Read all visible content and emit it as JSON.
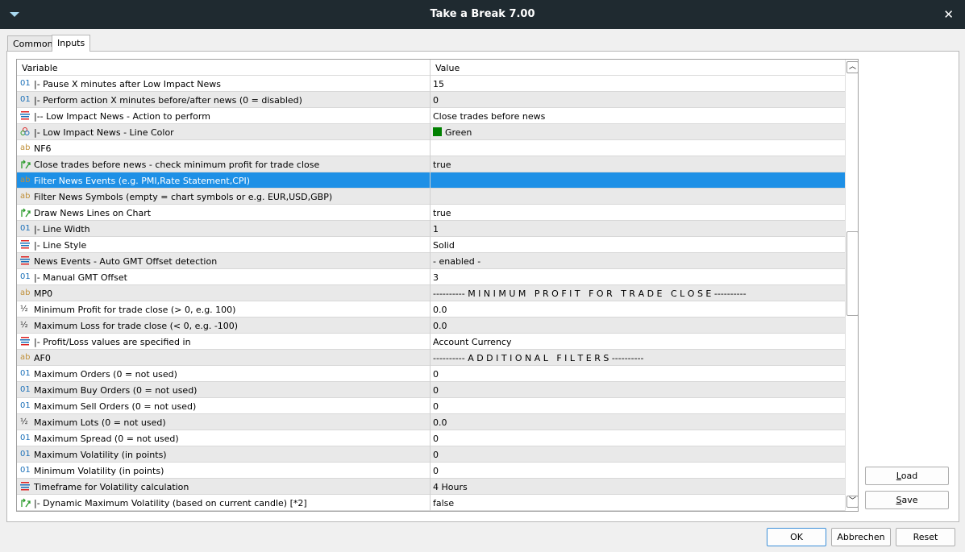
{
  "window": {
    "title": "Take a Break 7.00",
    "close": "✕"
  },
  "tabs": [
    {
      "label": "Common"
    },
    {
      "label": "Inputs"
    }
  ],
  "table": {
    "col_variable": "Variable",
    "col_value": "Value",
    "rows": [
      {
        "icon": "int",
        "variable": "|- Pause X minutes after Low Impact News",
        "value": "15"
      },
      {
        "icon": "int",
        "variable": "|- Perform action X minutes before/after news (0 = disabled)",
        "value": "0"
      },
      {
        "icon": "enum",
        "variable": "|-- Low Impact News - Action to perform",
        "value": "Close trades before news"
      },
      {
        "icon": "color",
        "variable": "|- Low Impact News - Line Color",
        "value": "Green",
        "swatch": "#008000"
      },
      {
        "icon": "string",
        "variable": "NF6",
        "value": ""
      },
      {
        "icon": "bool",
        "variable": "Close trades before news - check minimum profit for trade close",
        "value": "true"
      },
      {
        "icon": "string",
        "variable": "Filter News Events (e.g. PMI,Rate Statement,CPI)",
        "value": "",
        "selected": true
      },
      {
        "icon": "string",
        "variable": "Filter News Symbols (empty = chart symbols or e.g. EUR,USD,GBP)",
        "value": ""
      },
      {
        "icon": "bool",
        "variable": "Draw News Lines on Chart",
        "value": "true"
      },
      {
        "icon": "int",
        "variable": "|- Line Width",
        "value": "1"
      },
      {
        "icon": "enum",
        "variable": "|- Line Style",
        "value": "Solid"
      },
      {
        "icon": "enum",
        "variable": "News Events - Auto GMT Offset detection",
        "value": "- enabled -"
      },
      {
        "icon": "int",
        "variable": "|- Manual GMT Offset",
        "value": "3"
      },
      {
        "icon": "string",
        "variable": "MP0",
        "value": "---------- M I N I M U M   P R O F I T   F O R   T R A D E   C L O S E ----------"
      },
      {
        "icon": "double",
        "variable": "Minimum Profit for trade close (> 0, e.g. 100)",
        "value": "0.0"
      },
      {
        "icon": "double",
        "variable": "Maximum Loss for trade close (< 0, e.g. -100)",
        "value": "0.0"
      },
      {
        "icon": "enum",
        "variable": "|- Profit/Loss values are specified in",
        "value": "Account Currency"
      },
      {
        "icon": "string",
        "variable": "AF0",
        "value": "---------- A D D I T I O N A L   F I L T E R S ----------"
      },
      {
        "icon": "int",
        "variable": "Maximum Orders (0 = not used)",
        "value": "0"
      },
      {
        "icon": "int",
        "variable": "Maximum Buy Orders (0 = not used)",
        "value": "0"
      },
      {
        "icon": "int",
        "variable": "Maximum Sell Orders (0 = not used)",
        "value": "0"
      },
      {
        "icon": "double",
        "variable": "Maximum Lots (0 = not used)",
        "value": "0.0"
      },
      {
        "icon": "int",
        "variable": "Maximum Spread (0 = not used)",
        "value": "0"
      },
      {
        "icon": "int",
        "variable": "Maximum Volatility (in points)",
        "value": "0"
      },
      {
        "icon": "int",
        "variable": "Minimum Volatility (in points)",
        "value": "0"
      },
      {
        "icon": "enum",
        "variable": "Timeframe for Volatility calculation",
        "value": "4 Hours"
      },
      {
        "icon": "bool",
        "variable": "|- Dynamic Maximum Volatility (based on current candle) [*2]",
        "value": "false"
      }
    ]
  },
  "side_buttons": {
    "load_first": "L",
    "load_rest": "oad",
    "save_first": "S",
    "save_rest": "ave"
  },
  "buttons": {
    "ok": "OK",
    "cancel": "Abbrechen",
    "reset": "Reset"
  }
}
